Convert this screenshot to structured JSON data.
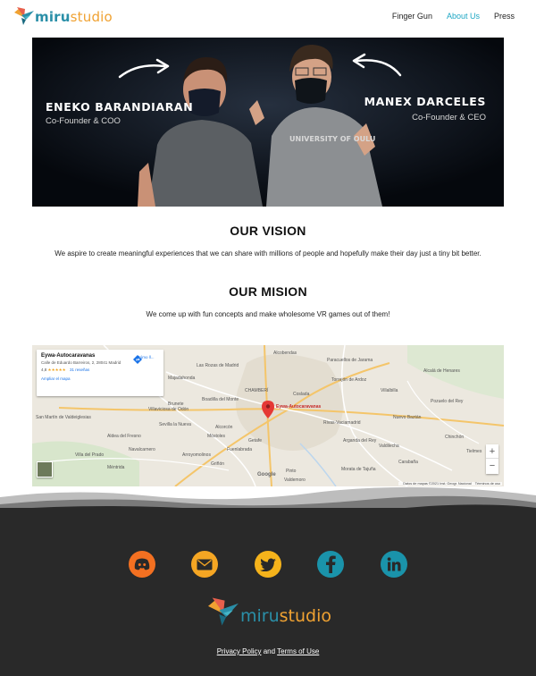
{
  "brand": {
    "logo_miru": "miru",
    "logo_studio": "studio",
    "colors": {
      "teal": "#2a8fa8",
      "orange": "#f0a232",
      "link_active": "#1ea7c4"
    }
  },
  "nav": {
    "items": [
      {
        "label": "Finger Gun",
        "active": false
      },
      {
        "label": "About Us",
        "active": true
      },
      {
        "label": "Press",
        "active": false
      }
    ]
  },
  "hero": {
    "left": {
      "name": "ENEKO BARANDIARAN",
      "role": "Co-Founder & COO"
    },
    "right": {
      "name": "MANEX DARCELES",
      "role": "Co-Founder & CEO"
    },
    "shirt_text": "UNIVERSITY OF OULU"
  },
  "vision": {
    "title": "OUR VISION",
    "text": "We aspire to create meaningful experiences that we can share with millions of people and hopefully make their day just a tiny bit better."
  },
  "mision": {
    "title": "OUR MISION",
    "text": "We come up with fun concepts and make wholesome VR games out of them!"
  },
  "map": {
    "card": {
      "title": "Eywa-Autocaravanas",
      "address": "Calle de Eduardo Barreiros, 2, 28041 Madrid",
      "rating": "4,8",
      "stars": "★★★★★",
      "reviews": "31 reseñas",
      "enlarge": "Ampliar el mapa",
      "directions": "Cómo ll..."
    },
    "pin_label": "Eywa-Autocaravanas",
    "zoom_in": "+",
    "zoom_out": "−",
    "google": "Google",
    "attribution": "Datos de mapas ©2021 Inst. Geogr. Nacional",
    "terms": "Términos de uso",
    "places": [
      "Alcobendas",
      "Las Rozas de Madrid",
      "Torrejón de Ardoz",
      "Alcalá de Henares",
      "Majadahonda",
      "Coslada",
      "Boadilla del Monte",
      "Brunete",
      "Alcorcón",
      "Móstoles",
      "Getafe",
      "Fuenlabrada",
      "Pinto",
      "Arganda del Rey",
      "Navalcarnero",
      "Valdemoro",
      "Villaviciosa de Odón",
      "CHAMBERÍ",
      "San Martín de Valdeiglesias",
      "Villalbilla",
      "Nuevo Baztán",
      "Paracuellos de Jarama",
      "Pozuelo del Rey",
      "Rivas-Vaciamadrid",
      "Villa del Prado",
      "Carabaña",
      "Valdilecha",
      "Morata de Tajuña",
      "Arroyomolinos",
      "Griñón",
      "Sevilla la Nueva",
      "Aldea del Fresno",
      "Méntrida",
      "Chinchón",
      "Tielmes"
    ]
  },
  "footer": {
    "social": [
      {
        "name": "discord",
        "color": "#f37021"
      },
      {
        "name": "email",
        "color": "#f5a623"
      },
      {
        "name": "twitter",
        "color": "#f5b31b"
      },
      {
        "name": "facebook",
        "color": "#1a93aa"
      },
      {
        "name": "linkedin",
        "color": "#1a93aa"
      }
    ],
    "privacy": "Privacy Policy",
    "and": "and",
    "terms": "Terms of Use"
  }
}
